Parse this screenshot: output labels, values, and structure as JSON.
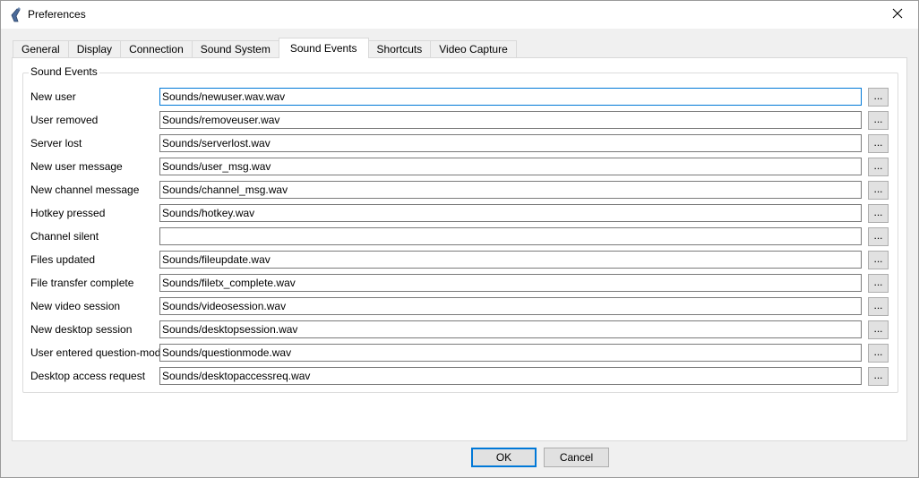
{
  "window": {
    "title": "Preferences",
    "close_glyph": "✕"
  },
  "tabs": [
    {
      "label": "General"
    },
    {
      "label": "Display"
    },
    {
      "label": "Connection"
    },
    {
      "label": "Sound System"
    },
    {
      "label": "Sound Events",
      "active": true
    },
    {
      "label": "Shortcuts"
    },
    {
      "label": "Video Capture"
    }
  ],
  "group": {
    "title": "Sound Events",
    "browse_label": "...",
    "rows": [
      {
        "label": "New user",
        "value": "Sounds/newuser.wav.wav"
      },
      {
        "label": "User removed",
        "value": "Sounds/removeuser.wav"
      },
      {
        "label": "Server lost",
        "value": "Sounds/serverlost.wav"
      },
      {
        "label": "New user message",
        "value": "Sounds/user_msg.wav"
      },
      {
        "label": "New channel message",
        "value": "Sounds/channel_msg.wav"
      },
      {
        "label": "Hotkey pressed",
        "value": "Sounds/hotkey.wav"
      },
      {
        "label": "Channel silent",
        "value": ""
      },
      {
        "label": "Files updated",
        "value": "Sounds/fileupdate.wav"
      },
      {
        "label": "File transfer complete",
        "value": "Sounds/filetx_complete.wav"
      },
      {
        "label": "New video session",
        "value": "Sounds/videosession.wav"
      },
      {
        "label": "New desktop session",
        "value": "Sounds/desktopsession.wav"
      },
      {
        "label": "User entered question-mode",
        "value": "Sounds/questionmode.wav"
      },
      {
        "label": "Desktop access request",
        "value": "Sounds/desktopaccessreq.wav"
      }
    ]
  },
  "buttons": {
    "ok": "OK",
    "cancel": "Cancel"
  },
  "colors": {
    "accent": "#0078d7",
    "window_bg": "#f0f0f0",
    "panel_bg": "#ffffff"
  },
  "icons": {
    "app": "app-icon",
    "close": "close-icon"
  }
}
